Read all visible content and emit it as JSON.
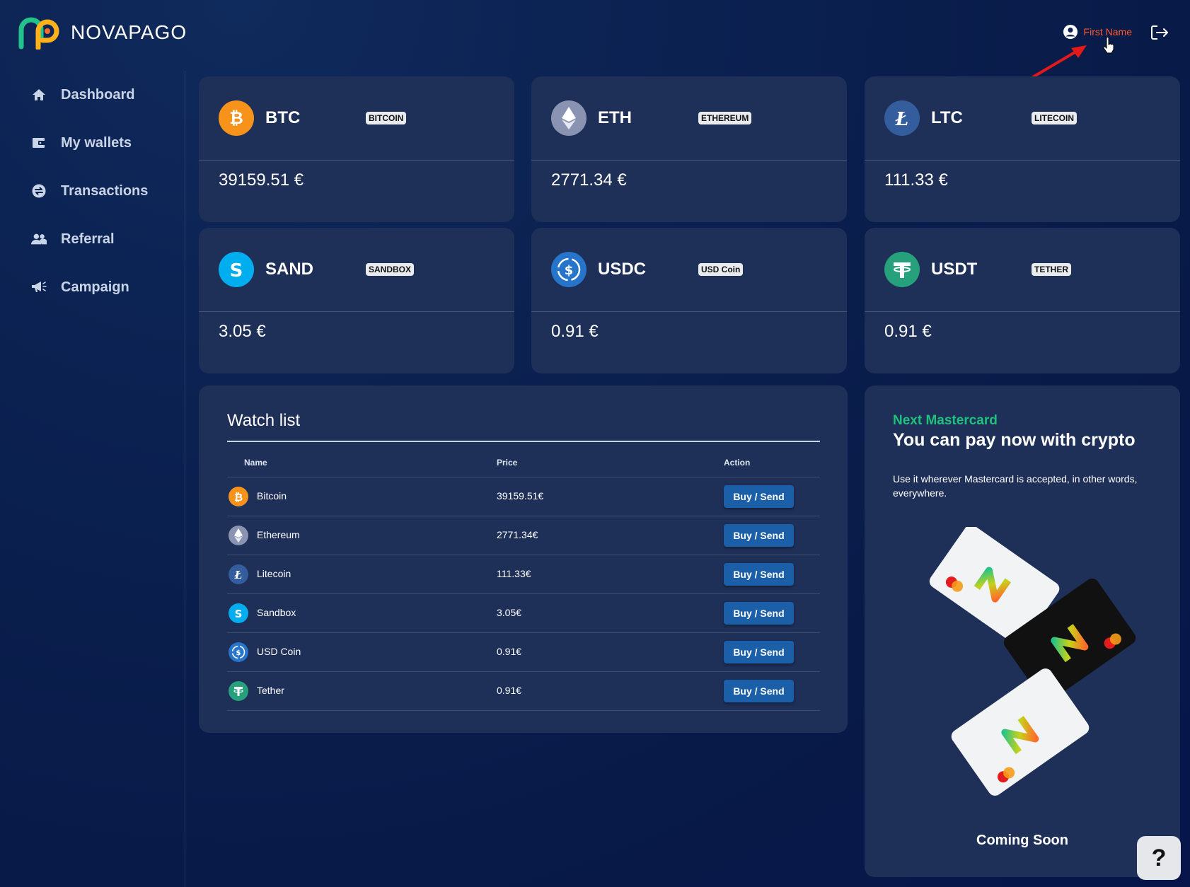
{
  "brand": {
    "name": "NOVAPAGO"
  },
  "header": {
    "user_name": "First Name"
  },
  "sidebar": {
    "items": [
      {
        "label": "Dashboard"
      },
      {
        "label": "My wallets"
      },
      {
        "label": "Transactions"
      },
      {
        "label": "Referral"
      },
      {
        "label": "Campaign"
      }
    ]
  },
  "coins": [
    {
      "symbol": "BTC",
      "tag": "BITCOIN",
      "price": "39159.51 €",
      "color": "#f7931a"
    },
    {
      "symbol": "ETH",
      "tag": "ETHEREUM",
      "price": "2771.34 €",
      "color": "#8a93b2"
    },
    {
      "symbol": "LTC",
      "tag": "LITECOIN",
      "price": "111.33 €",
      "color": "#345d9d"
    },
    {
      "symbol": "SAND",
      "tag": "SANDBOX",
      "price": "3.05 €",
      "color": "#00adef"
    },
    {
      "symbol": "USDC",
      "tag": "USD Coin",
      "price": "0.91 €",
      "color": "#2775ca"
    },
    {
      "symbol": "USDT",
      "tag": "TETHER",
      "price": "0.91 €",
      "color": "#26a17b"
    }
  ],
  "watchlist": {
    "title": "Watch list",
    "columns": {
      "name": "Name",
      "price": "Price",
      "action": "Action"
    },
    "rows": [
      {
        "name": "Bitcoin",
        "price": "39159.51€",
        "action": "Buy / Send"
      },
      {
        "name": "Ethereum",
        "price": "2771.34€",
        "action": "Buy / Send"
      },
      {
        "name": "Litecoin",
        "price": "111.33€",
        "action": "Buy / Send"
      },
      {
        "name": "Sandbox",
        "price": "3.05€",
        "action": "Buy / Send"
      },
      {
        "name": "USD Coin",
        "price": "0.91€",
        "action": "Buy / Send"
      },
      {
        "name": "Tether",
        "price": "0.91€",
        "action": "Buy / Send"
      }
    ]
  },
  "promo": {
    "kicker": "Next Mastercard",
    "title": "You can pay now with crypto",
    "subtitle": "Use it wherever Mastercard is accepted, in other words, everywhere.",
    "status": "Coming Soon"
  },
  "help": {
    "label": "?"
  }
}
